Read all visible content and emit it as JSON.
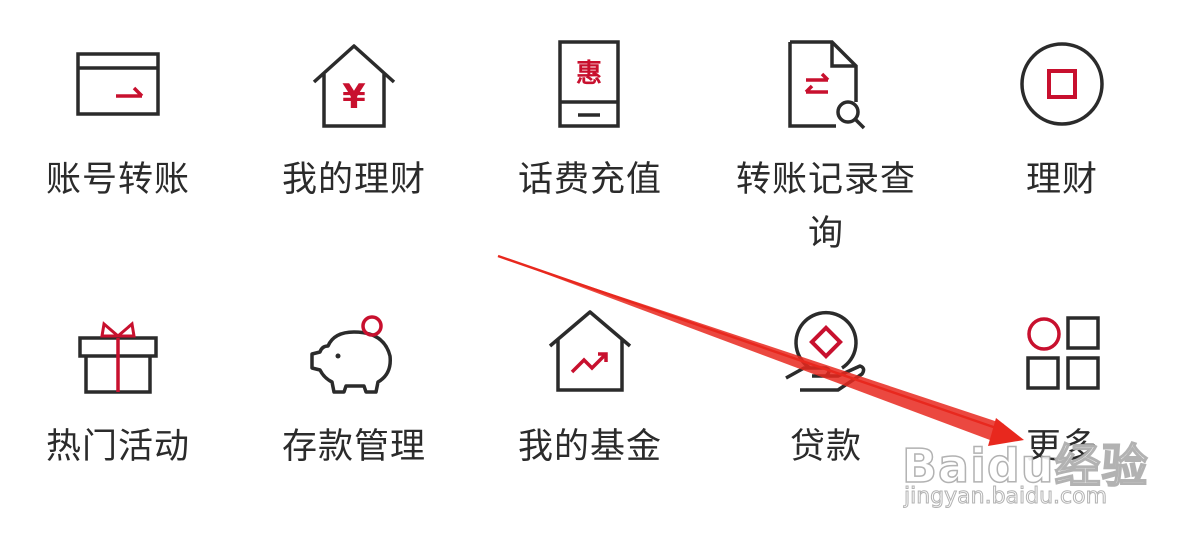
{
  "menu": {
    "items": [
      {
        "label": "账号转账",
        "icon": "card-transfer-icon"
      },
      {
        "label": "我的理财",
        "icon": "house-yen-icon"
      },
      {
        "label": "话费充值",
        "icon": "phone-hui-icon"
      },
      {
        "label": "转账记录查询",
        "icon": "document-search-icon"
      },
      {
        "label": "理财",
        "icon": "circle-square-icon"
      },
      {
        "label": "热门活动",
        "icon": "gift-box-icon"
      },
      {
        "label": "存款管理",
        "icon": "piggy-bank-icon"
      },
      {
        "label": "我的基金",
        "icon": "house-trend-icon"
      },
      {
        "label": "贷款",
        "icon": "hand-coin-icon"
      },
      {
        "label": "更多",
        "icon": "more-grid-icon"
      }
    ],
    "icon_glyphs": {
      "phone": "惠",
      "yen": "¥"
    }
  },
  "annotation": {
    "type": "red-arrow",
    "color": "#e8281e",
    "points_to": "更多"
  },
  "watermark": {
    "logo": "Baidu经验",
    "url": "jingyan.baidu.com"
  },
  "colors": {
    "icon_stroke": "#2b2b2b",
    "accent": "#c8102e",
    "text": "#2b2b2b"
  }
}
